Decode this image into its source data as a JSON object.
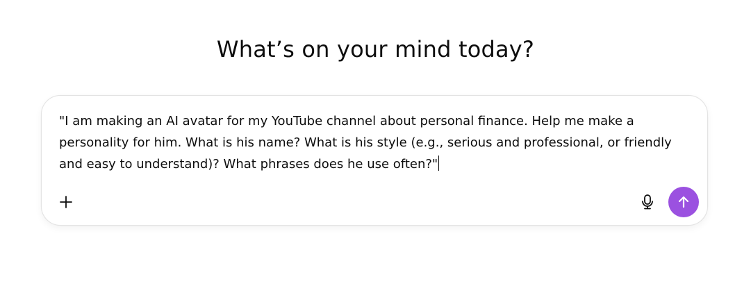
{
  "page": {
    "title": "What’s on your mind today?"
  },
  "composer": {
    "text": "\"I am making an AI avatar for my YouTube channel about personal finance. Help me make a personality for him. What is his name? What is his style (e.g., serious and professional, or friendly and easy to understand)? What phrases does he use often?\"",
    "add_icon": "plus-icon",
    "mic_icon": "microphone-icon",
    "send_icon": "arrow-up-icon",
    "send_color": "#9b51e0"
  }
}
